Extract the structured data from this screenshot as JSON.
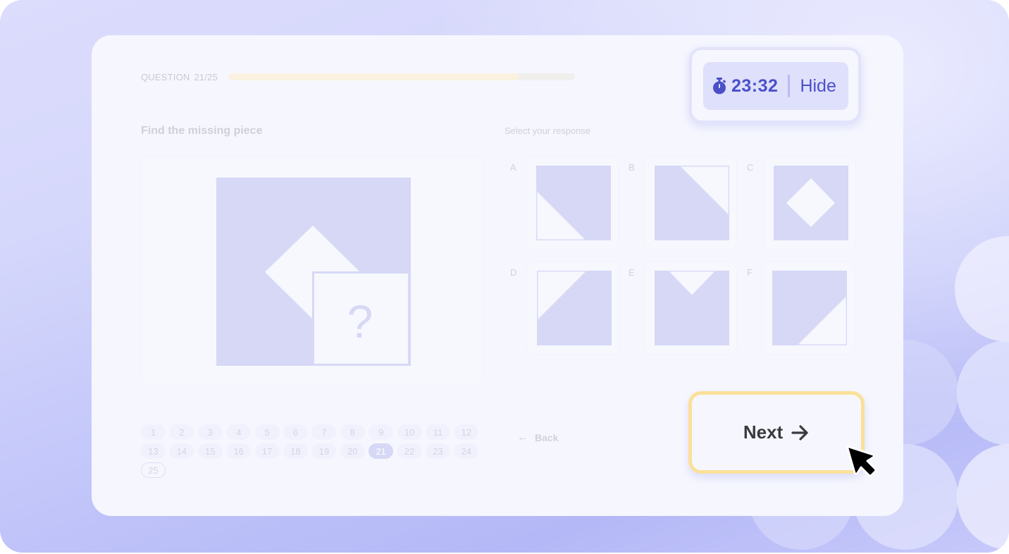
{
  "header": {
    "question_label": "QUESTION",
    "question_count": "21/25",
    "progress_fraction": 0.84
  },
  "timer": {
    "icon": "stopwatch-icon",
    "value": "23:32",
    "hide_label": "Hide"
  },
  "question": {
    "prompt": "Find the missing piece",
    "missing_marker": "?"
  },
  "responses": {
    "label": "Select your response",
    "options": [
      {
        "letter": "A",
        "shape": "white triangle bottom-left"
      },
      {
        "letter": "B",
        "shape": "white triangle top-right"
      },
      {
        "letter": "C",
        "shape": "white diamond center"
      },
      {
        "letter": "D",
        "shape": "white triangle top-left"
      },
      {
        "letter": "E",
        "shape": "white notch top-center"
      },
      {
        "letter": "F",
        "shape": "white triangle bottom-right"
      }
    ]
  },
  "pager": {
    "pages": [
      "1",
      "2",
      "3",
      "4",
      "5",
      "6",
      "7",
      "8",
      "9",
      "10",
      "11",
      "12",
      "13",
      "14",
      "15",
      "16",
      "17",
      "18",
      "19",
      "20",
      "21",
      "22",
      "23",
      "24",
      "25"
    ],
    "current": "21"
  },
  "navigation": {
    "back_label": "Back",
    "next_label": "Next"
  },
  "colors": {
    "accent": "#4b50c8",
    "shape_fill": "#d6d8f5",
    "next_border": "#fbe09a",
    "card_bg": "#f6f7fe"
  }
}
